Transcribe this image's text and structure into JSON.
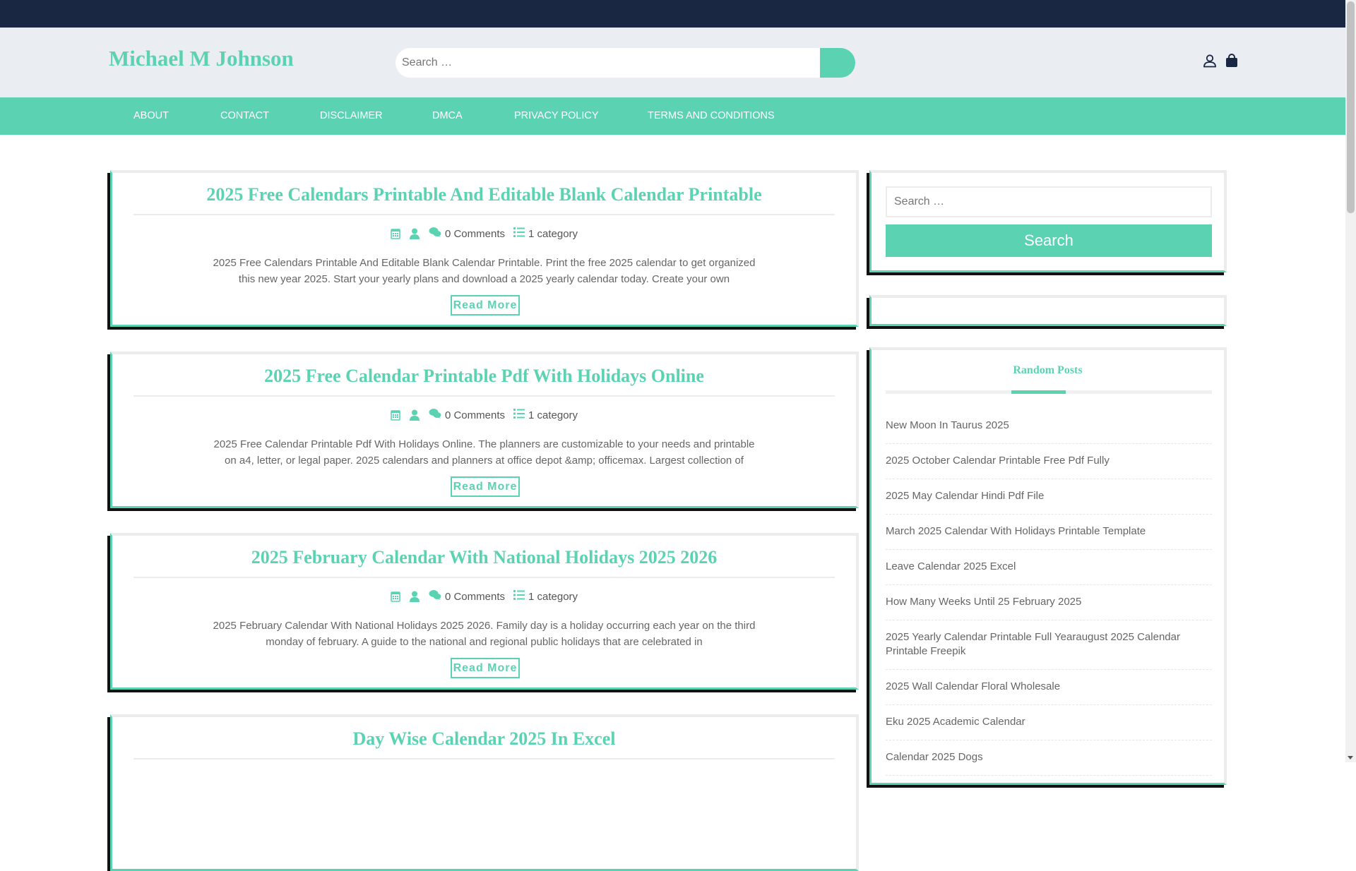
{
  "site_title": "Michael M Johnson",
  "header_search": {
    "placeholder": "Search …"
  },
  "nav": [
    "ABOUT",
    "CONTACT",
    "DISCLAIMER",
    "DMCA",
    "PRIVACY POLICY",
    "TERMS AND CONDITIONS"
  ],
  "posts": [
    {
      "title": "2025 Free Calendars Printable And Editable Blank Calendar Printable",
      "comments": "0 Comments",
      "category": "1 category",
      "excerpt": "2025 Free Calendars Printable And Editable Blank Calendar Printable. Print the free 2025 calendar to get organized this new year 2025. Start your yearly plans and download a 2025 yearly calendar today. Create your own",
      "read_more": "Read More"
    },
    {
      "title": "2025 Free Calendar Printable Pdf With Holidays Online",
      "comments": "0 Comments",
      "category": "1 category",
      "excerpt": "2025 Free Calendar Printable Pdf With Holidays Online. The planners are customizable to your needs and printable on a4, letter, or legal paper. 2025 calendars and planners at office depot &amp; officemax. Largest collection of",
      "read_more": "Read More"
    },
    {
      "title": "2025 February Calendar With National Holidays 2025 2026",
      "comments": "0 Comments",
      "category": "1 category",
      "excerpt": "2025 February Calendar With National Holidays 2025 2026. Family day is a holiday occurring each year on the third monday of february. A guide to the national and regional public holidays that are celebrated in",
      "read_more": "Read More"
    },
    {
      "title": "Day Wise Calendar 2025 In Excel"
    }
  ],
  "sidebar": {
    "search_placeholder": "Search …",
    "search_button": "Search",
    "random_posts_title": "Random Posts",
    "random_posts": [
      "New Moon In Taurus 2025",
      "2025 October Calendar Printable Free Pdf Fully",
      "2025 May Calendar Hindi Pdf File",
      "March 2025 Calendar With Holidays Printable Template",
      "Leave Calendar 2025 Excel",
      "How Many Weeks Until 25 February 2025",
      "2025 Yearly Calendar Printable Full Yearaugust 2025 Calendar Printable Freepik",
      "2025 Wall Calendar Floral Wholesale",
      "Eku 2025 Academic Calendar",
      "Calendar 2025 Dogs"
    ]
  },
  "colors": {
    "accent": "#5bd3b2",
    "topbar": "#1a2742",
    "header_bg": "#eaedf2"
  }
}
